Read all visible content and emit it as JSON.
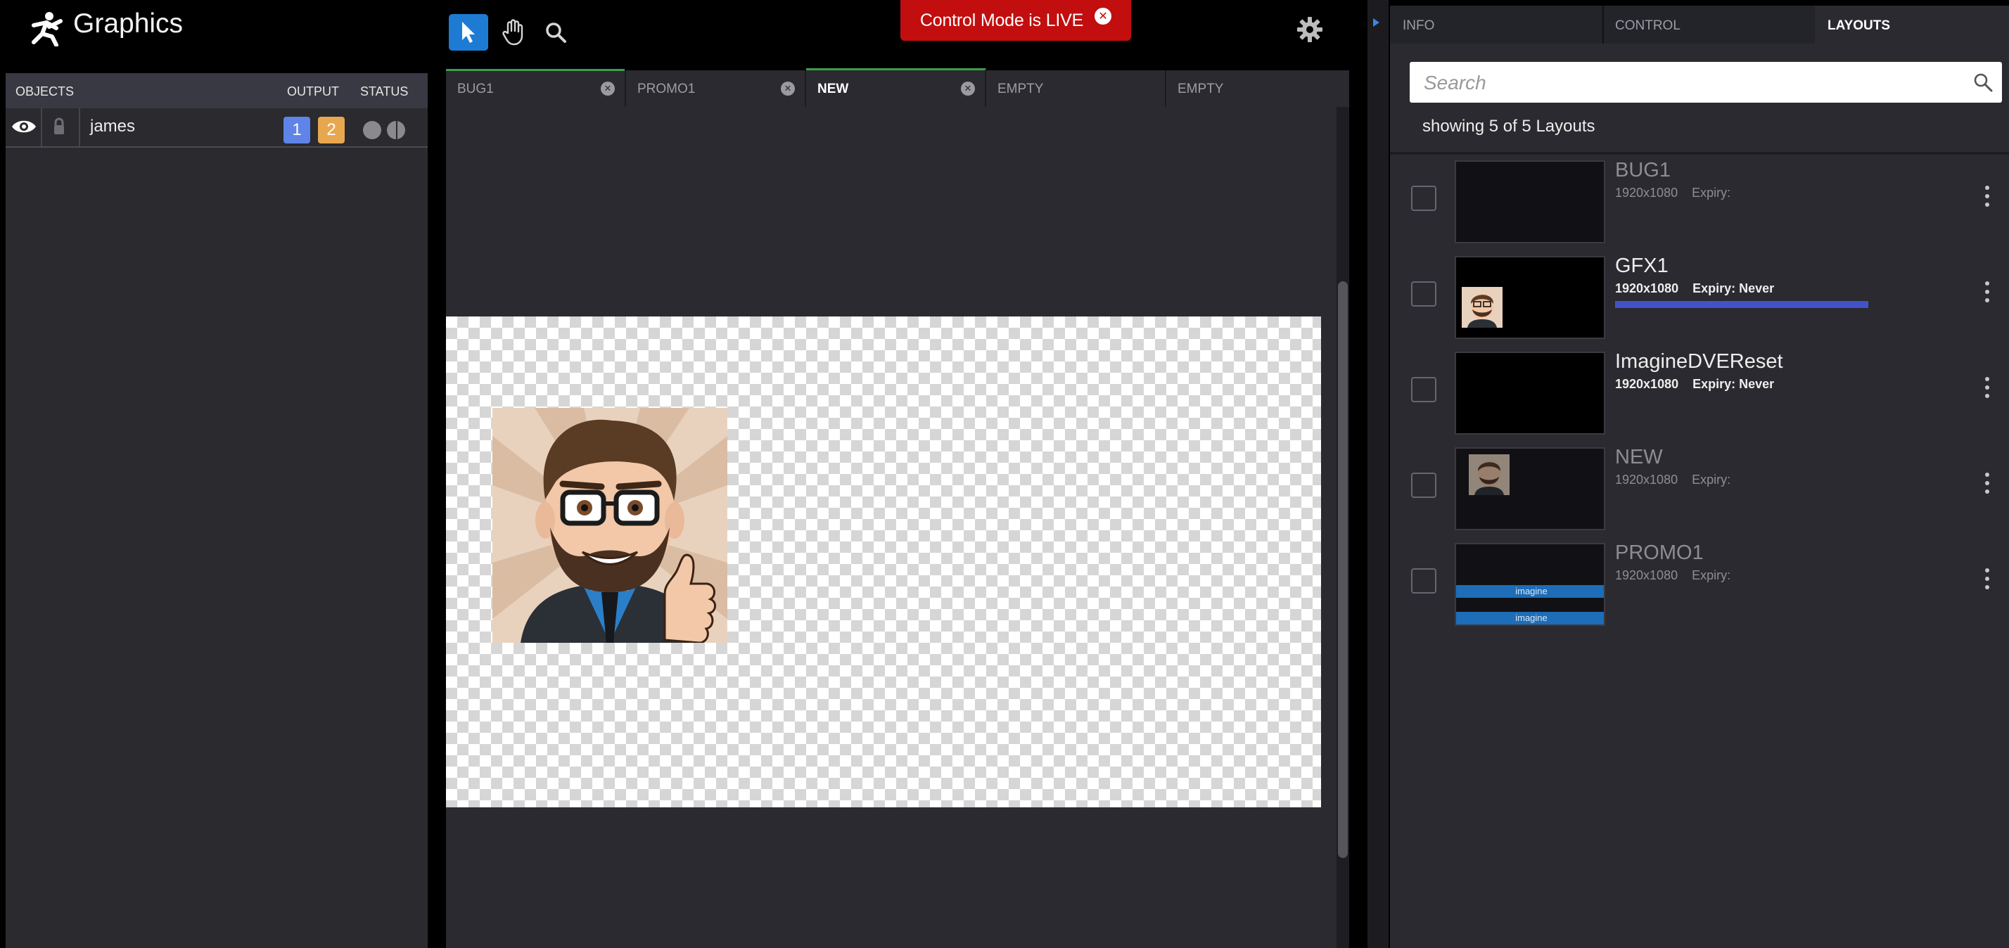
{
  "app": {
    "title": "Graphics",
    "logo_icon": "running-figure-logo"
  },
  "toolbar": {
    "tools": [
      "select-arrow-icon",
      "hand-pan-icon",
      "magnifier-zoom-icon"
    ],
    "active_tool": "select"
  },
  "banner": {
    "text": "Control Mode is LIVE",
    "color": "#c20e0e"
  },
  "objects_panel": {
    "headers": {
      "objects": "OBJECTS",
      "output": "OUTPUT",
      "status": "STATUS"
    },
    "rows": [
      {
        "name": "james",
        "outputs": [
          "1",
          "2"
        ],
        "output_colors": [
          "#5f84e8",
          "#e7a74f"
        ]
      }
    ]
  },
  "editor_tabs": [
    {
      "label": "BUG1",
      "closable": true
    },
    {
      "label": "PROMO1",
      "closable": true
    },
    {
      "label": "NEW",
      "closable": true,
      "selected": true
    },
    {
      "label": "EMPTY",
      "closable": false
    },
    {
      "label": "EMPTY",
      "closable": false
    }
  ],
  "right_panel": {
    "tabs": [
      "INFO",
      "CONTROL",
      "LAYOUTS"
    ],
    "active_tab": "LAYOUTS",
    "search": {
      "placeholder": "Search",
      "value": ""
    },
    "showing_text": "showing 5 of 5 Layouts",
    "layouts": [
      {
        "name": "BUG1",
        "resolution": "1920x1080",
        "expiry": "Expiry:"
      },
      {
        "name": "GFX1",
        "resolution": "1920x1080",
        "expiry": "Expiry: Never",
        "progress": 1.0
      },
      {
        "name": "ImagineDVEReset",
        "resolution": "1920x1080",
        "expiry": "Expiry: Never"
      },
      {
        "name": "NEW",
        "resolution": "1920x1080",
        "expiry": "Expiry:"
      },
      {
        "name": "PROMO1",
        "resolution": "1920x1080",
        "expiry": "Expiry:",
        "thumb_text": "imagine"
      }
    ]
  },
  "colors": {
    "accent": "#1e7bd3",
    "progress": "#4253c9",
    "panel": "#2a2a30"
  }
}
